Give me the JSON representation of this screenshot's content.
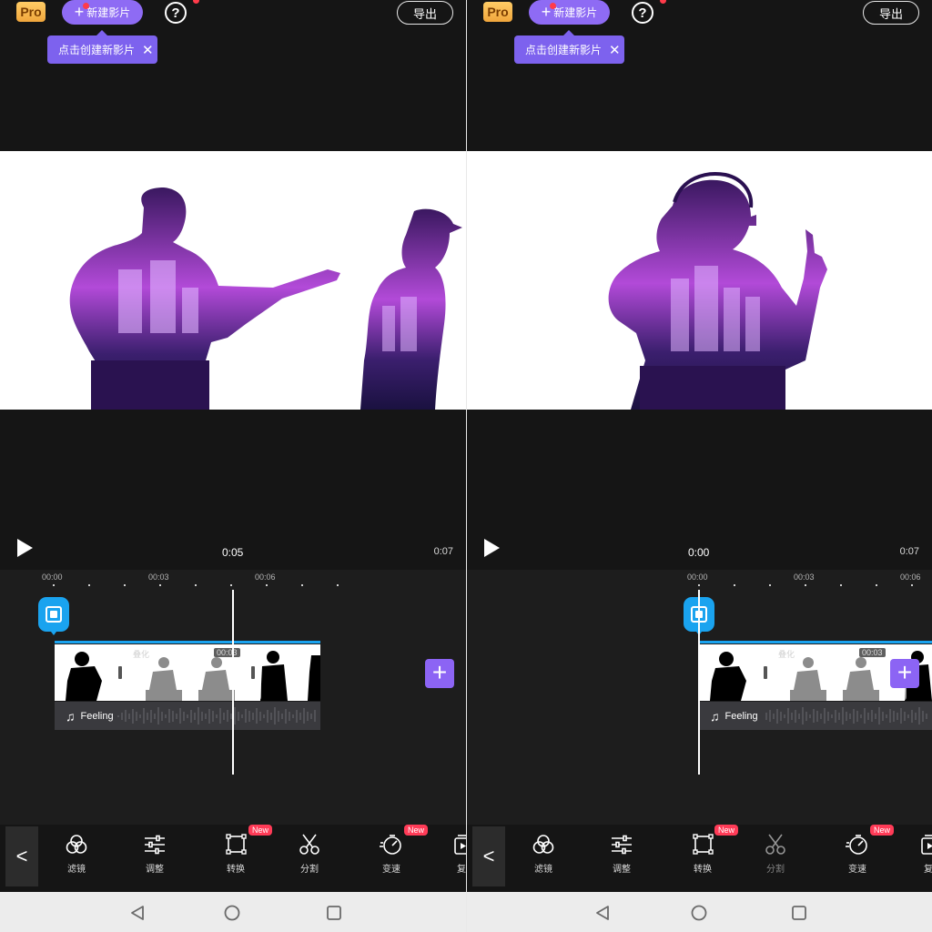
{
  "header": {
    "pro_label": "Pro",
    "new_movie_label": "新建影片",
    "help_label": "?",
    "export_label": "导出",
    "tooltip_text": "点击创建新影片",
    "tooltip_close": "✕"
  },
  "player": {
    "left_current_time": "0:05",
    "right_current_time": "0:00",
    "total_time": "0:07"
  },
  "ruler": {
    "labels": [
      "00:00",
      "00:03",
      "00:06"
    ]
  },
  "timeline": {
    "transition_name": "叠化",
    "transition_duration": "00:03",
    "audio_track_name": "Feeling",
    "add_label": "+"
  },
  "toolbar": {
    "back_label": "<",
    "tools": [
      {
        "label": "滤镜",
        "icon": "filter-icon",
        "badge": ""
      },
      {
        "label": "调整",
        "icon": "adjust-sliders-icon",
        "badge": ""
      },
      {
        "label": "转换",
        "icon": "transform-icon",
        "badge": "New"
      },
      {
        "label": "分割",
        "icon": "scissors-icon",
        "badge": ""
      },
      {
        "label": "变速",
        "icon": "speed-icon",
        "badge": "New"
      },
      {
        "label": "复",
        "icon": "duplicate-icon",
        "badge": ""
      }
    ]
  },
  "colors": {
    "accent_purple": "#8e6bf4",
    "timeline_blue": "#1aa3ef",
    "badge_red": "#ff3b57",
    "pro_gold": "#f0a63c"
  }
}
